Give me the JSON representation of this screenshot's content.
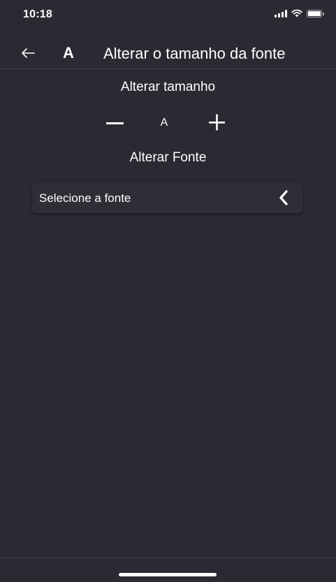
{
  "status_bar": {
    "time": "10:18"
  },
  "header": {
    "back_icon": "arrow-left-icon",
    "font_icon_glyph": "A",
    "title": "Alterar o tamanho da fonte"
  },
  "size_section": {
    "label": "Alterar tamanho",
    "preview": "A",
    "decrease_icon": "minus-icon",
    "increase_icon": "plus-icon"
  },
  "font_section": {
    "label": "Alterar Fonte",
    "select_placeholder": "Selecione a fonte",
    "select_icon": "chevron-left-icon"
  },
  "colors": {
    "background": "#2b2a33",
    "surface": "#2f2e37",
    "text": "#ffffff",
    "divider": "#44434d"
  }
}
